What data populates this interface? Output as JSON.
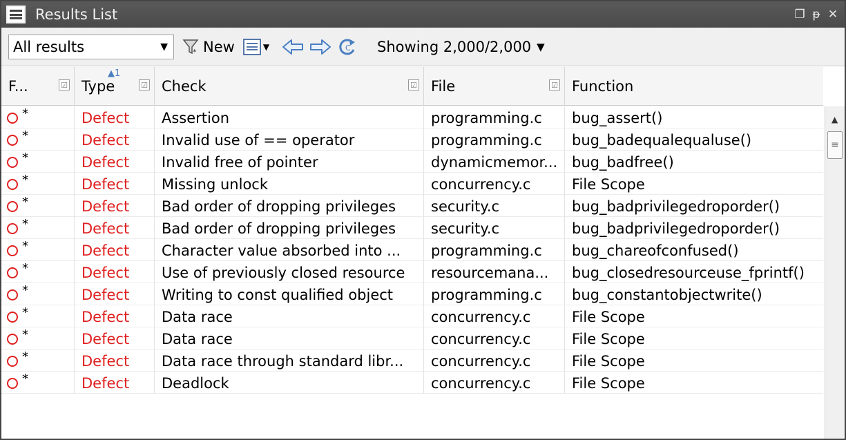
{
  "title": "Results List",
  "title_controls": [
    "restore",
    "pin",
    "close"
  ],
  "toolbar": {
    "filter_value": "All results",
    "new_label": "New",
    "showing": "Showing 2,000/2,000"
  },
  "columns": {
    "family": "F...",
    "type": "Type",
    "type_sort": "1",
    "check": "Check",
    "file": "File",
    "function": "Function"
  },
  "rows": [
    {
      "mark": "*",
      "type": "Defect",
      "check": "Assertion",
      "file": "programming.c",
      "function": "bug_assert()"
    },
    {
      "mark": "*",
      "type": "Defect",
      "check": "Invalid use of == operator",
      "file": "programming.c",
      "function": "bug_badequalequaluse()"
    },
    {
      "mark": "*",
      "type": "Defect",
      "check": "Invalid free of pointer",
      "file": "dynamicmemor...",
      "function": "bug_badfree()"
    },
    {
      "mark": "*",
      "type": "Defect",
      "check": "Missing unlock",
      "file": "concurrency.c",
      "function": "File Scope"
    },
    {
      "mark": "*",
      "type": "Defect",
      "check": "Bad order of dropping privileges",
      "file": "security.c",
      "function": "bug_badprivilegedroporder()"
    },
    {
      "mark": "*",
      "type": "Defect",
      "check": "Bad order of dropping privileges",
      "file": "security.c",
      "function": "bug_badprivilegedroporder()"
    },
    {
      "mark": "*",
      "type": "Defect",
      "check": "Character value absorbed into ...",
      "file": "programming.c",
      "function": "bug_chareofconfused()"
    },
    {
      "mark": "*",
      "type": "Defect",
      "check": "Use of previously closed resource",
      "file": "resourcemana...",
      "function": "bug_closedresourceuse_fprintf()"
    },
    {
      "mark": "*",
      "type": "Defect",
      "check": "Writing to const qualified object",
      "file": "programming.c",
      "function": "bug_constantobjectwrite()"
    },
    {
      "mark": "*",
      "type": "Defect",
      "check": "Data race",
      "file": "concurrency.c",
      "function": "File Scope"
    },
    {
      "mark": "*",
      "type": "Defect",
      "check": "Data race",
      "file": "concurrency.c",
      "function": "File Scope"
    },
    {
      "mark": "*",
      "type": "Defect",
      "check": "Data race through standard libr...",
      "file": "concurrency.c",
      "function": "File Scope"
    },
    {
      "mark": "*",
      "type": "Defect",
      "check": "Deadlock",
      "file": "concurrency.c",
      "function": "File Scope"
    }
  ],
  "colors": {
    "defect": "#e02020",
    "titlebar": "#4f4f4f"
  }
}
